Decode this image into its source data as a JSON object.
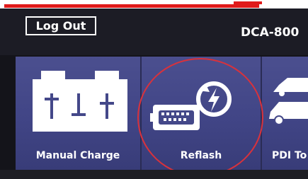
{
  "header": {
    "logout_label": "Log Out",
    "device_label": "DCA-800"
  },
  "tiles": [
    {
      "label": "Manual Charge",
      "icon": "battery-icon"
    },
    {
      "label": "Reflash",
      "icon": "ecu-reflash-icon"
    },
    {
      "label": "PDI To",
      "icon": "car-icon"
    }
  ],
  "colors": {
    "tile_bg": "#444889",
    "highlight": "#d8323c",
    "banner_red": "#e01a1a"
  }
}
